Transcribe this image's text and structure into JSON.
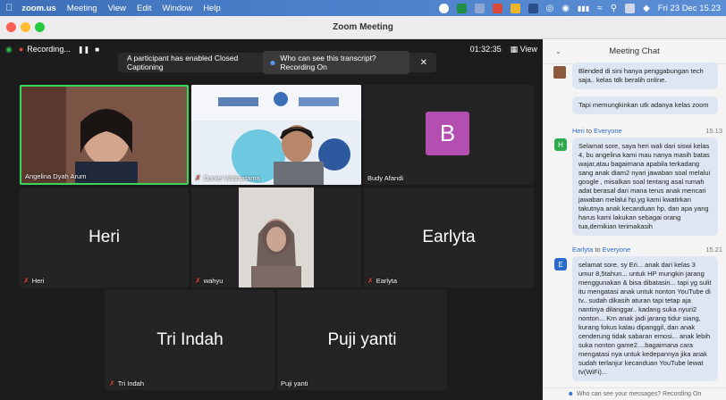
{
  "menubar": {
    "app": "zoom.us",
    "items": [
      "Meeting",
      "View",
      "Edit",
      "Window",
      "Help"
    ],
    "datetime": "Fri 23 Dec  15.23"
  },
  "window": {
    "title": "Zoom Meeting"
  },
  "topbar": {
    "recording": "Recording...",
    "timer": "01:32:35",
    "view": "View"
  },
  "cc_banner": {
    "text": "A participant has enabled Closed Captioning",
    "link": "Who can see this transcript? Recording On"
  },
  "participants": [
    {
      "name": "Angelina Dyah Arum",
      "muted": false
    },
    {
      "name": "Daniel Widhiatama",
      "muted": true
    },
    {
      "name": "Budy Afandi",
      "initial": "B",
      "muted": false
    },
    {
      "name": "Heri",
      "big": "Heri",
      "muted": true
    },
    {
      "name": "wahyu",
      "muted": true
    },
    {
      "name": "Earlyta",
      "big": "Earlyta",
      "muted": true
    },
    {
      "name": "Tri Indah",
      "big": "Tri Indah",
      "muted": true
    },
    {
      "name": "Puji yanti",
      "big": "Puji yanti",
      "muted": false
    }
  ],
  "chat": {
    "title": "Meeting Chat",
    "messages": [
      {
        "text": "Blended di sini hanya penggabungan tech saja.. kelas tdk beralih online."
      },
      {
        "text": "Tapi memungkinkan utk adanya kelas zoom"
      },
      {
        "from": "Heri",
        "to_word": "to",
        "to": "Everyone",
        "time": "15.13",
        "initial": "H",
        "text": "Selamat sore, saya heri wali dari siswi kelas 4, bu angelina kami mau nanya masih batas wajar,atau bagaimana apabila terkadang sang anak diam2 nyari jawaban soal melalui google , misalkan soal tentang asal rumah adat berasal dari mana terus anak mencari jawaban melalui hp,yg kami kwatirkan takutnya anak kecanduan hp, dan apa yang harus kami lakukan sebagai orang tua,demikian terimakasih"
      },
      {
        "from": "Earlyta",
        "to_word": "to",
        "to": "Everyone",
        "time": "15.21",
        "initial": "E",
        "text": "selamat sore, sy Eri... anak dari kelas 3 umur 8,5tahun... untuk HP mungkin jarang menggunakan & bisa dibatasin... tapi yg sulit itu mengatasi anak untuk nonton YouTube di tv.. sudah dikasih aturan tapi tetap aja nantinya dilanggar.. kadang suka nyuri2 nonton... Krn anak jadi jarang tidur siang, kurang fokus kalau dipanggil, dan anak cenderung tidak sabaran emosi... anak lebih suka nonton game2....bagaimana cara mengatasi nya untuk kedepannya jika anak sudah terlanjur kecanduan YouTube lewat tv(WiFi)..."
      }
    ],
    "footer": "Who can see your messages? Recording On"
  }
}
